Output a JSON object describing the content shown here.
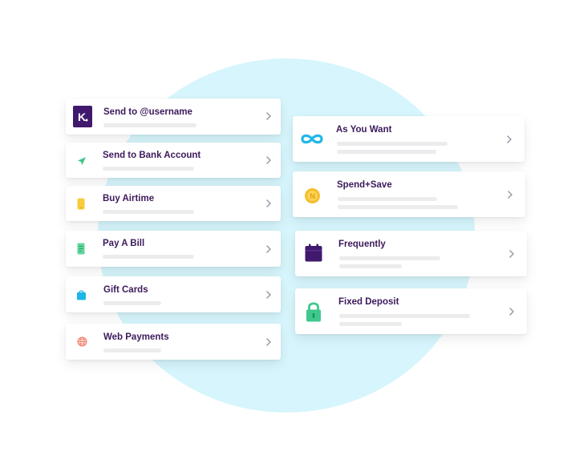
{
  "left_list": [
    {
      "label": "Send to @username",
      "icon": "kuda-logo-icon"
    },
    {
      "label": "Send to Bank Account",
      "icon": "paper-plane-icon"
    },
    {
      "label": "Buy Airtime",
      "icon": "phone-icon"
    },
    {
      "label": "Pay A Bill",
      "icon": "receipt-icon"
    },
    {
      "label": "Gift Cards",
      "icon": "shopping-bag-icon"
    },
    {
      "label": "Web Payments",
      "icon": "globe-icon"
    }
  ],
  "right_list": [
    {
      "label": "As You Want",
      "icon": "infinity-icon"
    },
    {
      "label": "Spend+Save",
      "icon": "coin-icon"
    },
    {
      "label": "Frequently",
      "icon": "calendar-icon"
    },
    {
      "label": "Fixed Deposit",
      "icon": "padlock-icon"
    }
  ],
  "colors": {
    "title": "#3c1a5b",
    "brand_purple": "#40196d",
    "circle": "#d6f5fc",
    "placeholder_line": "#ececef"
  }
}
